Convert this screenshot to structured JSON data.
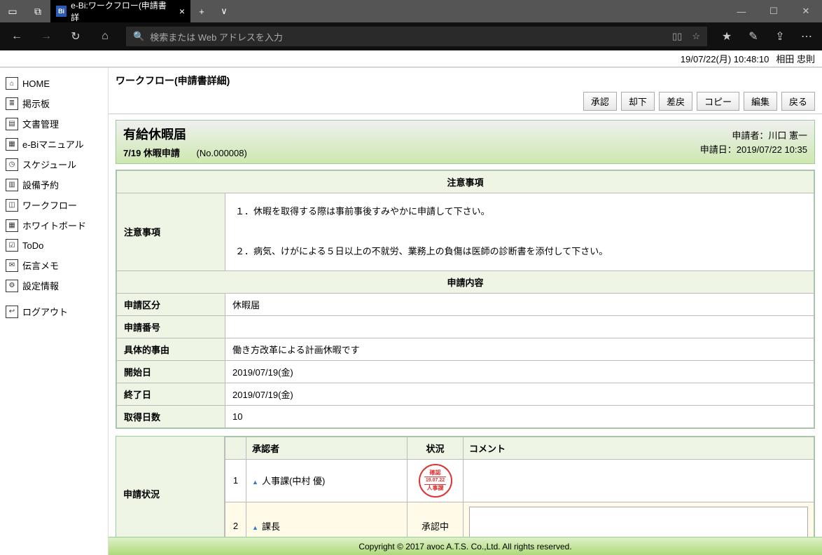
{
  "browser": {
    "tab_title": "e-Bi:ワークフロー(申請書詳",
    "url_placeholder": "検索または Web アドレスを入力"
  },
  "status": {
    "datetime": "19/07/22(月) 10:48:10",
    "user": "相田 忠則"
  },
  "sidebar": {
    "items": [
      {
        "label": "HOME"
      },
      {
        "label": "掲示板"
      },
      {
        "label": "文書管理"
      },
      {
        "label": "e-Biマニュアル"
      },
      {
        "label": "スケジュール"
      },
      {
        "label": "設備予約"
      },
      {
        "label": "ワークフロー"
      },
      {
        "label": "ホワイトボード"
      },
      {
        "label": "ToDo"
      },
      {
        "label": "伝言メモ"
      },
      {
        "label": "設定情報"
      },
      {
        "label": "ログアウト"
      }
    ]
  },
  "page": {
    "title": "ワークフロー(申請書詳細)"
  },
  "actions": {
    "approve": "承認",
    "reject": "却下",
    "remand": "差戻",
    "copy": "コピー",
    "edit": "編集",
    "back": "戻る"
  },
  "form": {
    "name": "有給休暇届",
    "subject": "7/19 休暇申請",
    "doc_no": "(No.000008)",
    "applicant_label": "申請者：",
    "applicant": "川口 憲一",
    "apply_date_label": "申請日：",
    "apply_date": "2019/07/22 10:35"
  },
  "sections": {
    "notice_h": "注意事項",
    "content_h": "申請内容",
    "notice_label": "注意事項",
    "notice_text": "１．休暇を取得する際は事前事後すみやかに申請して下さい。\n\n２．病気、けがによる５日以上の不就労、業務上の負傷は医師の診断書を添付して下さい。",
    "rows": {
      "category_l": "申請区分",
      "category_v": "休暇届",
      "number_l": "申請番号",
      "number_v": "",
      "reason_l": "具体的事由",
      "reason_v": "働き方改革による計画休暇です",
      "start_l": "開始日",
      "start_v": "2019/07/19(金)",
      "end_l": "終了日",
      "end_v": "2019/07/19(金)",
      "days_l": "取得日数",
      "days_v": "10"
    }
  },
  "approval": {
    "label": "申請状況",
    "headers": {
      "approver": "承認者",
      "status": "状況",
      "comment": "コメント"
    },
    "rows": [
      {
        "no": "1",
        "approver": "人事課(中村 優)",
        "status_stamp": {
          "top": "確認",
          "mid": "19.07.22",
          "bot": "人事課"
        }
      },
      {
        "no": "2",
        "approver": "課長",
        "status_text": "承認中"
      }
    ]
  },
  "footer": "Copyright © 2017 avoc A.T.S. Co.,Ltd. All rights reserved."
}
